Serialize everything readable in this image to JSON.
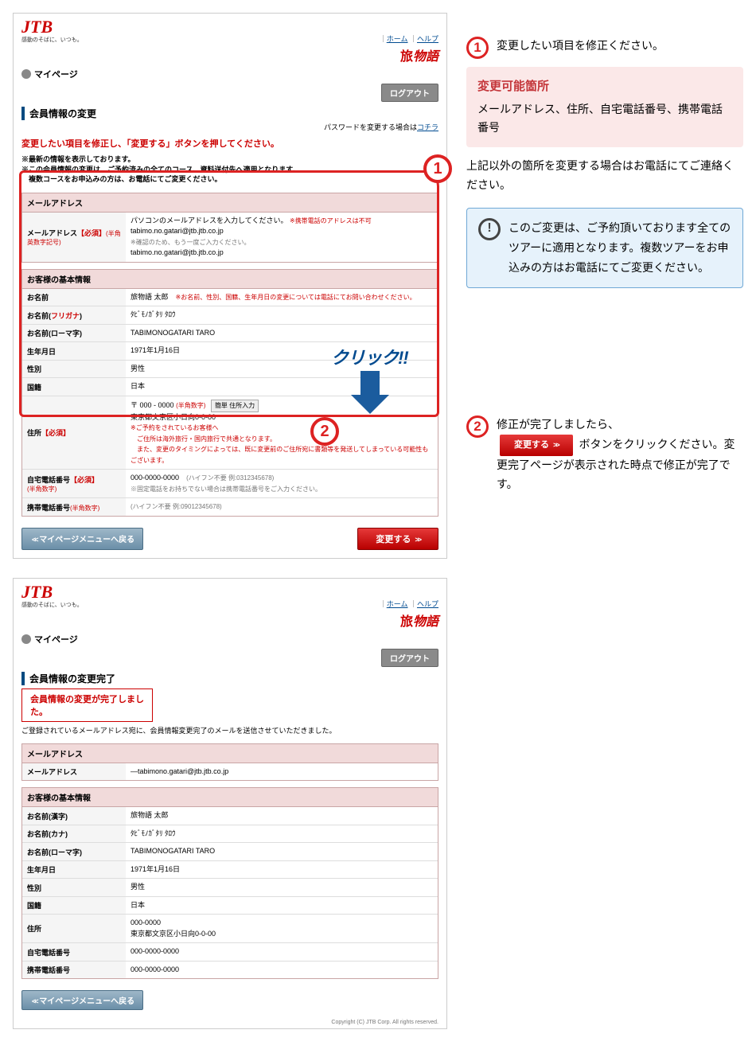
{
  "logo": {
    "text": "JTB",
    "tagline": "感動のそばに、いつも。"
  },
  "toplinks": {
    "home": "ホーム",
    "help": "ヘルプ"
  },
  "tabi_logo": "物語",
  "mypage": "マイページ",
  "logout": "ログアウト",
  "copyright": "Copyright (C) JTB Corp. All rights reserved.",
  "edit": {
    "title": "会員情報の変更",
    "pw_prefix": "パスワードを変更する場合は",
    "pw_link": "コチラ",
    "instruction": "変更したい項目を修正し、「変更する」ボタンを押してください。",
    "notes": [
      "※最新の情報を表示しております。",
      "※この会員情報の変更は、ご予約済みの全てのコース、資料送付先へ適用となります。",
      "　複数コースをお申込みの方は、お電話にてご変更ください。"
    ],
    "mail_hdr": "メールアドレス",
    "mail_label": "メールアドレス",
    "mail_req": "【必須】",
    "mail_half": "(半角英数字記号)",
    "mail_note1": "パソコンのメールアドレスを入力してください。",
    "mail_note1_red": "※携帯電話のアドレスは不可",
    "mail_val1": "tabimo.no.gatari@jtb.jtb.co.jp",
    "mail_note2": "※確認のため、もう一度ご入力ください。",
    "mail_val2": "tabimo.no.gatari@jtb.jtb.co.jp",
    "basic_hdr": "お客様の基本情報",
    "name_label": "お名前",
    "name_val": "旅物語 太郎",
    "name_note": "※お名前、性別、国籍、生年月日の変更については電話にてお問い合わせください。",
    "kana_label_pre": "お名前(",
    "kana_label_red": "フリガナ",
    "kana_label_post": ")",
    "kana_val": "ﾀﾋﾞﾓﾉｶﾞﾀﾘ ﾀﾛｳ",
    "roma_label": "お名前(ローマ字)",
    "roma_val": "TABIMONOGATARI TARO",
    "dob_label": "生年月日",
    "dob_val": "1971年1月16日",
    "sex_label": "性別",
    "sex_val": "男性",
    "nat_label": "国籍",
    "nat_val": "日本",
    "addr_label": "住所",
    "addr_req": "【必須】",
    "addr_zip_pre": "〒",
    "addr_zip": "000 - 0000",
    "addr_half": "(半角数字)",
    "addr_easy": "簡単 住所入力",
    "addr_val": "東京都文京区小日向0-0-00",
    "addr_note1": "※ご予約をされているお客様へ",
    "addr_note2": "　ご住所は海外旅行・国内旅行で共通となります。",
    "addr_note3": "　また、変更のタイミングによっては、既に変更前のご住所宛に書類等を発送してしまっている可能性もございます。",
    "home_tel_label": "自宅電話番号",
    "home_tel_req": "【必須】",
    "home_tel_half": "(半角数字)",
    "home_tel_val": "000-0000-0000",
    "home_tel_hint": "(ハイフン不要 例:0312345678)",
    "home_tel_note": "※固定電話をお持ちでない場合は携帯電話番号をご入力ください。",
    "mob_tel_label": "携帯電話番号",
    "mob_tel_half": "(半角数字)",
    "mob_tel_hint": "(ハイフン不要 例:09012345678)",
    "back_btn": "マイページメニューへ戻る",
    "change_btn": "変更する"
  },
  "done": {
    "title": "会員情報の変更完了",
    "complete_msg": "会員情報の変更が完了しました。",
    "complete_note": "ご登録されているメールアドレス宛に、会員情報変更完了のメールを送信させていただきました。",
    "mail_hdr": "メールアドレス",
    "mail_label": "メールアドレス",
    "mail_val": "—tabimono.gatari@jtb.jtb.co.jp",
    "basic_hdr": "お客様の基本情報",
    "name_label": "お名前(漢字)",
    "name_val": "旅物語 太郎",
    "kana_label": "お名前(カナ)",
    "kana_val": "ﾀﾋﾞﾓﾉｶﾞﾀﾘ ﾀﾛｳ",
    "roma_label": "お名前(ローマ字)",
    "roma_val": "TABIMONOGATARI TARO",
    "dob_label": "生年月日",
    "dob_val": "1971年1月16日",
    "sex_label": "性別",
    "sex_val": "男性",
    "nat_label": "国籍",
    "nat_val": "日本",
    "addr_label": "住所",
    "addr_zip": "000-0000",
    "addr_val": "東京都文京区小日向0-0-00",
    "home_tel_label": "自宅電話番号",
    "home_tel_val": "000-0000-0000",
    "mob_tel_label": "携帯電話番号",
    "mob_tel_val": "000-0000-0000",
    "back_btn": "マイページメニューへ戻る"
  },
  "right": {
    "num1": "1",
    "num1_text": "変更したい項目を修正ください。",
    "box1_title": "変更可能箇所",
    "box1_body": "メールアドレス、住所、自宅電話番号、携帯電話番号",
    "box1_after": "上記以外の箇所を変更する場合はお電話にてご連絡ください。",
    "excl": "!",
    "box2_body": "このご変更は、ご予約頂いております全てのツアーに適用となります。複数ツアーをお申込みの方はお電話にてご変更ください。",
    "num2": "2",
    "num2_text1": "修正が完了しましたら、",
    "num2_btn": "変更する",
    "num2_text2": "ボタンをクリックください。変更完了ページが表示された時点で修正が完了です。"
  },
  "overlay": {
    "click": "クリック!!"
  }
}
